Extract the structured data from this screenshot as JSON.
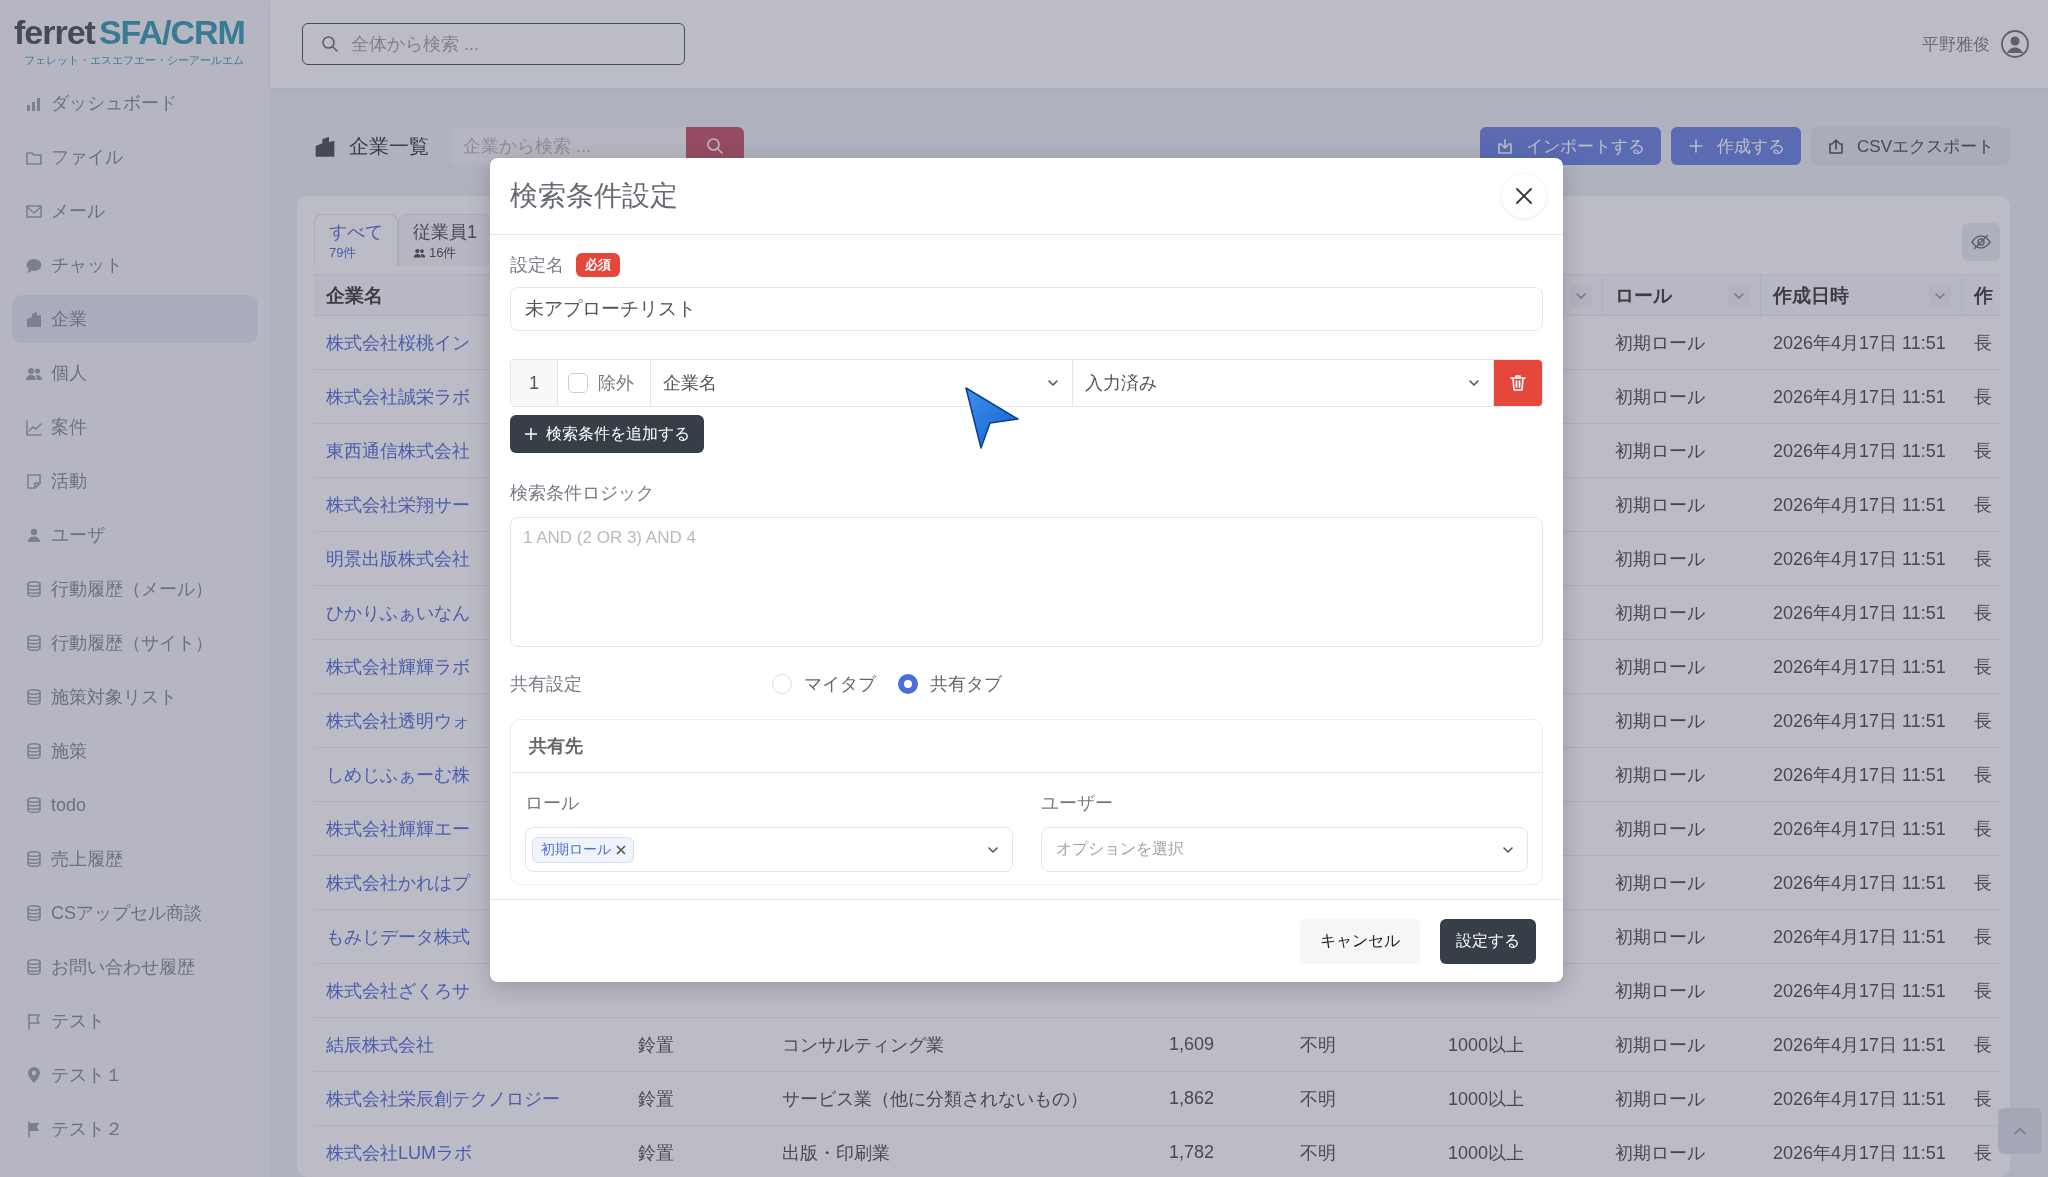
{
  "app": {
    "logo": "ferret",
    "logo_accent": "SFA/CRM",
    "logo_sub": "フェレット・エスエフエー・シーアールエム",
    "search_placeholder": "全体から検索 ...",
    "user_name": "平野雅俊"
  },
  "sidebar": {
    "items": [
      {
        "label": "ダッシュボード",
        "selected": false
      },
      {
        "label": "ファイル",
        "selected": false
      },
      {
        "label": "メール",
        "selected": false
      },
      {
        "label": "チャット",
        "selected": false
      },
      {
        "label": "企業",
        "selected": true
      },
      {
        "label": "個人",
        "selected": false
      },
      {
        "label": "案件",
        "selected": false
      },
      {
        "label": "活動",
        "selected": false
      },
      {
        "label": "ユーザ",
        "selected": false
      },
      {
        "label": "行動履歴（メール）",
        "selected": false
      },
      {
        "label": "行動履歴（サイト）",
        "selected": false
      },
      {
        "label": "施策対象リスト",
        "selected": false
      },
      {
        "label": "施策",
        "selected": false
      },
      {
        "label": "todo",
        "selected": false
      },
      {
        "label": "売上履歴",
        "selected": false
      },
      {
        "label": "CSアップセル商談",
        "selected": false
      },
      {
        "label": "お問い合わせ履歴",
        "selected": false
      },
      {
        "label": "テスト",
        "selected": false
      },
      {
        "label": "テスト１",
        "selected": false
      },
      {
        "label": "テスト２",
        "selected": false
      }
    ]
  },
  "page": {
    "title": "企業一覧",
    "search_placeholder": "企業から検索 ...",
    "actions": [
      {
        "label": "インポートする",
        "kind": "primary"
      },
      {
        "label": "作成する",
        "kind": "primary"
      },
      {
        "label": "CSVエクスポート",
        "kind": "secondary"
      }
    ]
  },
  "tabs": [
    {
      "label": "すべて",
      "count": "79件",
      "selected": true
    },
    {
      "label": "従業員1",
      "count": "16件",
      "selected": false
    }
  ],
  "table": {
    "header": {
      "company": {
        "label": "企業名"
      },
      "column_6": {
        "sortable": true
      },
      "role": {
        "label": "ロール",
        "sortable": true
      },
      "created": {
        "label": "作成日時",
        "sortable": true
      },
      "column_9": {
        "label": "作"
      }
    },
    "rows": [
      {
        "company": "株式会社桜桃イン",
        "role": "初期ロール",
        "created": "2026年4月17日 11:51",
        "column_9": "長"
      },
      {
        "company": "株式会社誠栄ラボ",
        "role": "初期ロール",
        "created": "2026年4月17日 11:51",
        "column_9": "長"
      },
      {
        "company": "東西通信株式会社",
        "role": "初期ロール",
        "created": "2026年4月17日 11:51",
        "column_9": "長"
      },
      {
        "company": "株式会社栄翔サー",
        "role": "初期ロール",
        "created": "2026年4月17日 11:51",
        "column_9": "長"
      },
      {
        "company": "明景出版株式会社",
        "role": "初期ロール",
        "created": "2026年4月17日 11:51",
        "column_9": "長"
      },
      {
        "company": "ひかりふぁいなん",
        "role": "初期ロール",
        "created": "2026年4月17日 11:51",
        "column_9": "長"
      },
      {
        "company": "株式会社輝輝ラボ",
        "role": "初期ロール",
        "created": "2026年4月17日 11:51",
        "column_9": "長"
      },
      {
        "company": "株式会社透明ウォ",
        "role": "初期ロール",
        "created": "2026年4月17日 11:51",
        "column_9": "長"
      },
      {
        "company": "しめじふぁーむ株",
        "role": "初期ロール",
        "created": "2026年4月17日 11:51",
        "column_9": "長"
      },
      {
        "company": "株式会社輝輝エー",
        "role": "初期ロール",
        "created": "2026年4月17日 11:51",
        "column_9": "長"
      },
      {
        "company": "株式会社かれはプ",
        "role": "初期ロール",
        "created": "2026年4月17日 11:51",
        "column_9": "長"
      },
      {
        "company": "もみじデータ株式",
        "role": "初期ロール",
        "created": "2026年4月17日 11:51",
        "column_9": "長"
      },
      {
        "company": "株式会社ざくろサ",
        "role": "初期ロール",
        "created": "2026年4月17日 11:51",
        "column_9": "長"
      },
      {
        "company": "結辰株式会社",
        "column_2": "鈴置",
        "column_3": "コンサルティング業",
        "column_4": "1,609",
        "column_5": "不明",
        "column_6": "1000以上",
        "role": "初期ロール",
        "created": "2026年4月17日 11:51",
        "column_9": "長"
      },
      {
        "company": "株式会社栄辰創テクノロジー",
        "column_2": "鈴置",
        "column_3": "サービス業（他に分類されないもの）",
        "column_4": "1,862",
        "column_5": "不明",
        "column_6": "1000以上",
        "role": "初期ロール",
        "created": "2026年4月17日 11:51",
        "column_9": "長"
      },
      {
        "company": "株式会社LUMラボ",
        "column_2": "鈴置",
        "column_3": "出版・印刷業",
        "column_4": "1,782",
        "column_5": "不明",
        "column_6": "1000以上",
        "role": "初期ロール",
        "created": "2026年4月17日 11:51",
        "column_9": "長"
      }
    ]
  },
  "dialog": {
    "title": "検索条件設定",
    "name_label": "設定名",
    "required_badge": "必須",
    "name_value": "未アプローチリスト",
    "conditions": [
      {
        "number": "1",
        "exclude_label": "除外",
        "excluded": false,
        "field": "企業名",
        "operator": "入力済み"
      }
    ],
    "add_button": "検索条件を追加する",
    "logic_label": "検索条件ロジック",
    "logic_placeholder": "1 AND (2 OR 3) AND 4",
    "share_label": "共有設定",
    "share_options": [
      {
        "label": "マイタブ",
        "selected": false
      },
      {
        "label": "共有タブ",
        "selected": true
      }
    ],
    "share_target": {
      "title": "共有先",
      "role_label": "ロール",
      "role_tags": [
        "初期ロール"
      ],
      "user_label": "ユーザー",
      "user_placeholder": "オプションを選択"
    },
    "buttons": [
      {
        "label": "キャンセル",
        "kind": "secondary"
      },
      {
        "label": "設定する",
        "kind": "primary"
      }
    ]
  }
}
